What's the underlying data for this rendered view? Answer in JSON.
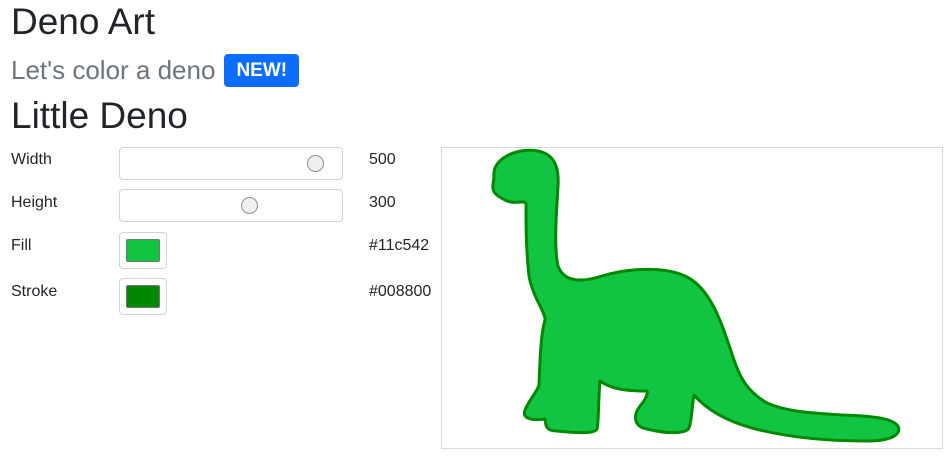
{
  "header": {
    "app_title": "Deno Art",
    "subtitle": "Let's color a deno",
    "badge": "NEW!"
  },
  "section": {
    "title": "Little Deno"
  },
  "controls": {
    "width": {
      "label": "Width",
      "value": "500",
      "slider_fraction": 0.91
    },
    "height": {
      "label": "Height",
      "value": "300",
      "slider_fraction": 0.59
    },
    "fill": {
      "label": "Fill",
      "value": "#11c542"
    },
    "stroke": {
      "label": "Stroke",
      "value": "#008800"
    }
  },
  "colors": {
    "badge_bg": "#0d6efd",
    "fill": "#11c542",
    "stroke": "#008800"
  },
  "icons": {
    "canvas_image": "dinosaur-silhouette"
  }
}
